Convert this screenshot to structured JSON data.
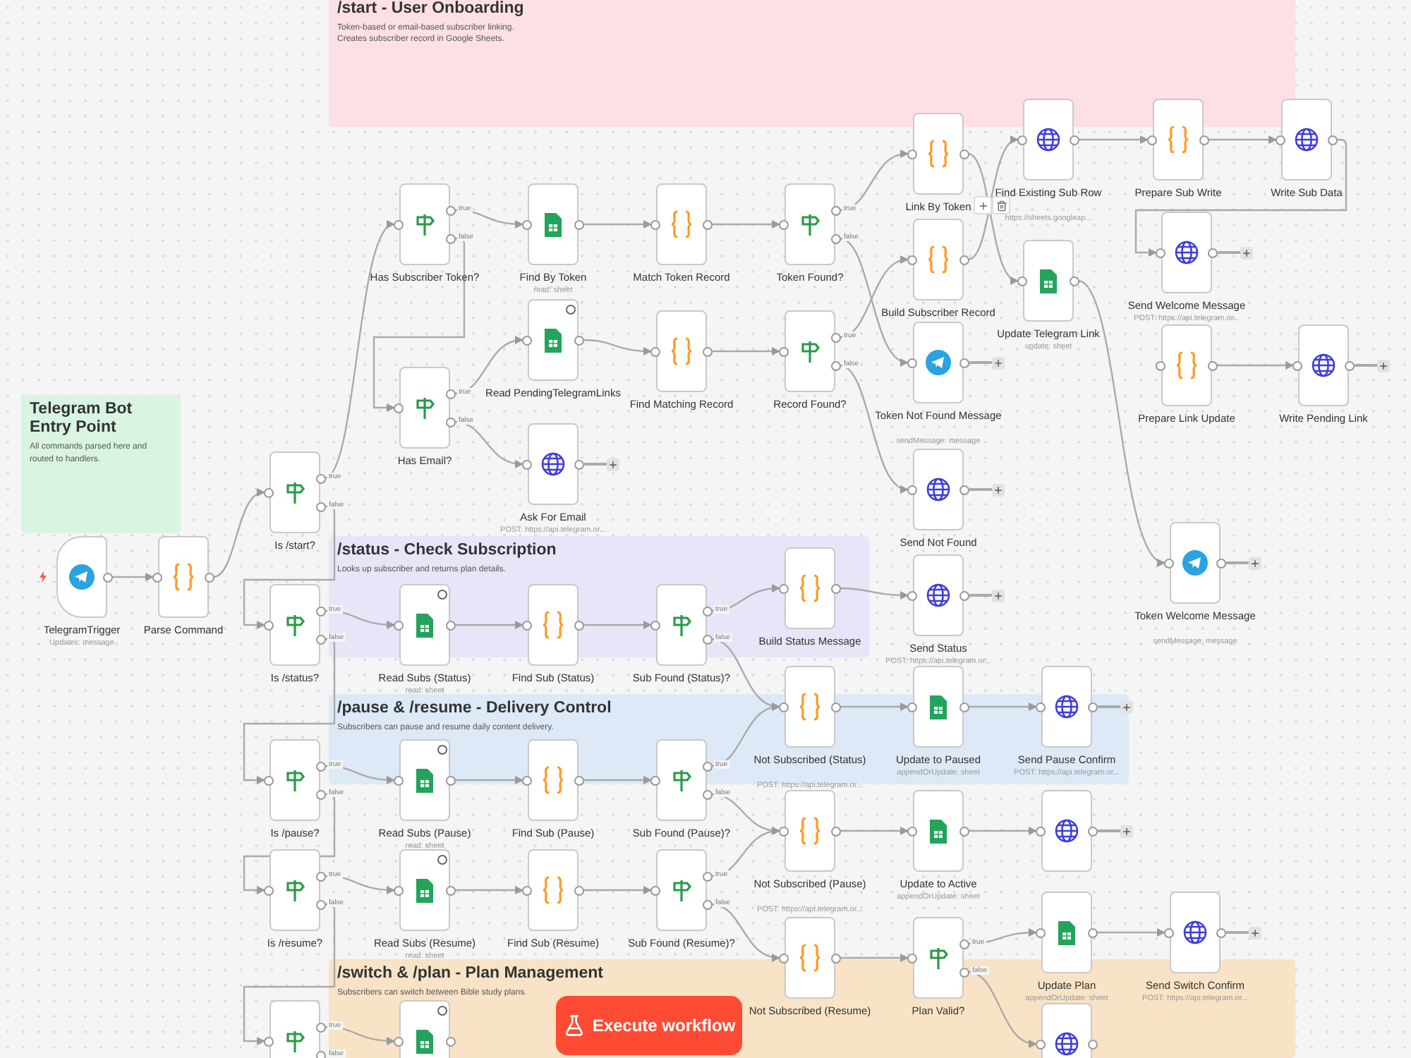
{
  "notes": [
    {
      "title": "/start - User Onboarding",
      "text": "Token-based or email-based subscriber linking.\nCreates subscriber record in Google Sheets.",
      "color": "#fde0e3"
    },
    {
      "title": "Telegram Bot Entry Point",
      "text": "All commands parsed here and routed to handlers.",
      "color": "#d9f5e1"
    },
    {
      "title": "/status - Check Subscription",
      "text": "Looks up subscriber and returns plan details.",
      "color": "#e9e4f7"
    },
    {
      "title": "/pause & /resume - Delivery Control",
      "text": "Subscribers can pause and resume daily content delivery.",
      "color": "#dde9f7"
    },
    {
      "title": "/switch & /plan - Plan Management",
      "text": "Subscribers can switch between Bible study plans.",
      "color": "#f8e3c6"
    }
  ],
  "nodes": [
    {
      "kind": "trigger",
      "label": "TelegramTrigger",
      "subtitle": "Updates: message"
    },
    {
      "kind": "code",
      "label": "Parse Command"
    },
    {
      "kind": "if",
      "label": "Is /start?",
      "outputs": [
        "true",
        "false"
      ]
    },
    {
      "kind": "if",
      "label": "Is /status?",
      "outputs": [
        "true",
        "false"
      ]
    },
    {
      "kind": "if",
      "label": "Is /pause?",
      "outputs": [
        "true",
        "false"
      ]
    },
    {
      "kind": "if",
      "label": "Is /resume?",
      "outputs": [
        "true",
        "false"
      ]
    },
    {
      "kind": "if",
      "outputs": [
        "true",
        "false"
      ]
    },
    {
      "kind": "if",
      "label": "Has Subscriber Token?",
      "outputs": [
        "true",
        "false"
      ]
    },
    {
      "kind": "if",
      "label": "Has Email?",
      "outputs": [
        "true",
        "false"
      ]
    },
    {
      "kind": "sheets",
      "label": "Find By Token",
      "subtitle": "read: sheet"
    },
    {
      "kind": "sheets",
      "label": "Read PendingTelegramLinks",
      "badge": true
    },
    {
      "kind": "http",
      "label": "Ask For Email",
      "subtitle": "POST: https://api.telegram.or...",
      "add_stub": true
    },
    {
      "kind": "code",
      "label": "Match Token Record"
    },
    {
      "kind": "code",
      "label": "Find Matching Record"
    },
    {
      "kind": "if",
      "label": "Token Found?",
      "outputs": [
        "true",
        "false"
      ]
    },
    {
      "kind": "if",
      "label": "Record Found?",
      "outputs": [
        "true",
        "false"
      ]
    },
    {
      "kind": "code",
      "label": "Link By Token"
    },
    {
      "kind": "code",
      "label": "Build Subscriber Record"
    },
    {
      "kind": "telegram",
      "label": "Token Not Found Message",
      "subtitle": "sendMessage: message",
      "add_stub": true
    },
    {
      "kind": "http",
      "label": "Send Not Found",
      "add_stub": true
    },
    {
      "kind": "http",
      "label": "Find Existing Sub Row",
      "subtitle": "https://sheets.googleap..."
    },
    {
      "kind": "sheets",
      "label": "Update Telegram Link",
      "subtitle": "update: sheet"
    },
    {
      "kind": "code",
      "label": "Prepare Sub Write"
    },
    {
      "kind": "http",
      "label": "Write Sub Data"
    },
    {
      "kind": "http",
      "label": "Send Welcome Message",
      "subtitle": "POST: https://api.telegram.or...",
      "add_stub": true
    },
    {
      "kind": "code",
      "label": "Prepare Link Update"
    },
    {
      "kind": "http",
      "label": "Write Pending Link",
      "add_stub": true
    },
    {
      "kind": "telegram",
      "label": "Token Welcome Message",
      "subtitle": "sendMessage: message",
      "add_stub": true
    },
    {
      "kind": "sheets",
      "label": "Read Subs (Status)",
      "subtitle": "read: sheet",
      "badge": true
    },
    {
      "kind": "code",
      "label": "Find Sub (Status)"
    },
    {
      "kind": "if",
      "label": "Sub Found (Status)?",
      "outputs": [
        "true",
        "false"
      ]
    },
    {
      "kind": "code",
      "label": "Build Status Message"
    },
    {
      "kind": "http",
      "label": "Send Status",
      "subtitle": "POST: https://api.telegram.or...",
      "add_stub": true
    },
    {
      "kind": "sheets",
      "label": "Read Subs (Pause)",
      "subtitle": "read: sheet",
      "badge": true
    },
    {
      "kind": "code",
      "label": "Find Sub (Pause)"
    },
    {
      "kind": "if",
      "label": "Sub Found (Pause)?",
      "outputs": [
        "true",
        "false"
      ]
    },
    {
      "kind": "sheets",
      "label": "Read Subs (Resume)",
      "subtitle": "read: sheet",
      "badge": true
    },
    {
      "kind": "code",
      "label": "Find Sub (Resume)"
    },
    {
      "kind": "if",
      "label": "Sub Found (Resume)?",
      "outputs": [
        "true",
        "false"
      ]
    },
    {
      "kind": "code",
      "label": "Not Subscribed (Status)",
      "subtitle": "POST: https://api.telegram.or..."
    },
    {
      "kind": "sheets",
      "label": "Update to Paused",
      "subtitle": "appendOrUpdate: sheet"
    },
    {
      "kind": "http",
      "label": "Send Pause Confirm",
      "subtitle": "POST: https://api.telegram.or...",
      "add_stub": true
    },
    {
      "kind": "code",
      "label": "Not Subscribed (Pause)",
      "subtitle": "POST: https://api.telegram.or..."
    },
    {
      "kind": "sheets",
      "label": "Update to Active",
      "subtitle": "appendOrUpdate: sheet"
    },
    {
      "kind": "http",
      "add_stub": true
    },
    {
      "kind": "code",
      "label": "Not Subscribed (Resume)"
    },
    {
      "kind": "if",
      "label": "Plan Valid?",
      "outputs": [
        "true",
        "false"
      ]
    },
    {
      "kind": "sheets",
      "label": "Update Plan",
      "subtitle": "appendOrUpdate: sheet"
    },
    {
      "kind": "http",
      "label": "Send Switch Confirm",
      "subtitle": "POST: https://api.telegram.or...",
      "add_stub": true
    },
    {
      "kind": "http"
    },
    {
      "kind": "sheets",
      "badge": true
    }
  ],
  "execute_button": {
    "label": "Execute workflow"
  }
}
